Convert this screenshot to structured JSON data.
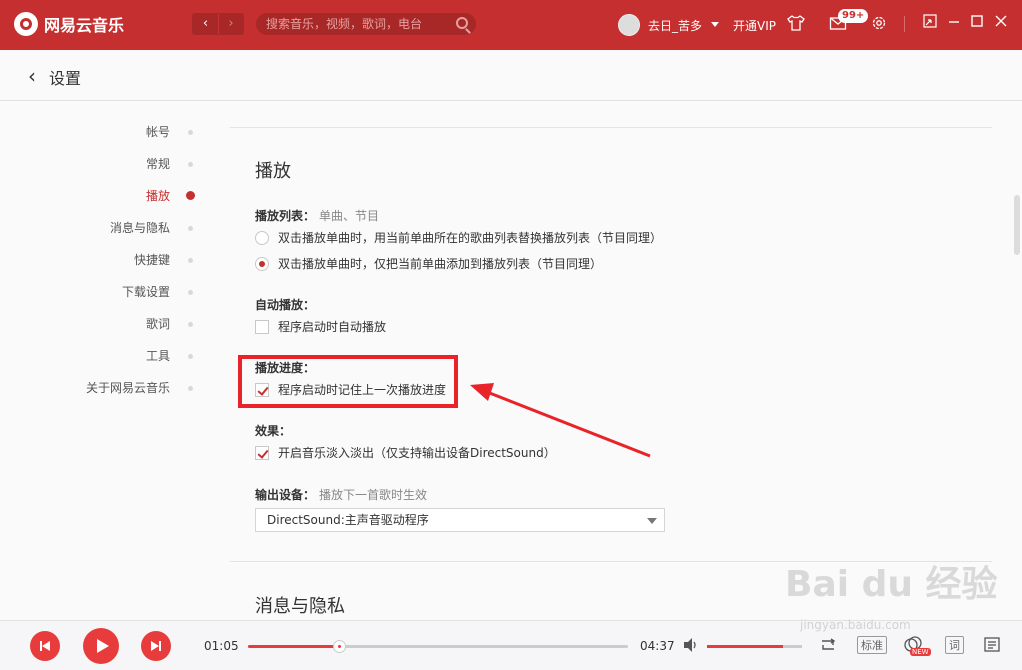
{
  "app": {
    "name": "网易云音乐"
  },
  "titlebar": {
    "nav_back": "‹",
    "nav_forward": "›",
    "search_placeholder": "搜索音乐，视频，歌词，电台",
    "username": "去日_苦多",
    "vip": "开通VIP",
    "message_badge": "99+"
  },
  "header": {
    "back": "‹",
    "title": "设置"
  },
  "sidebar": {
    "items": [
      {
        "label": "帐号"
      },
      {
        "label": "常规"
      },
      {
        "label": "播放",
        "active": true
      },
      {
        "label": "消息与隐私"
      },
      {
        "label": "快捷键"
      },
      {
        "label": "下载设置"
      },
      {
        "label": "歌词"
      },
      {
        "label": "工具"
      },
      {
        "label": "关于网易云音乐"
      }
    ]
  },
  "main": {
    "section_title": "播放",
    "playlist": {
      "label": "播放列表：",
      "hint": "单曲、节目",
      "options": [
        {
          "text": "双击播放单曲时，用当前单曲所在的歌曲列表替换播放列表（节目同理）",
          "selected": false
        },
        {
          "text": "双击播放单曲时，仅把当前单曲添加到播放列表（节目同理）",
          "selected": true
        }
      ]
    },
    "autoplay": {
      "label": "自动播放：",
      "option": "程序启动时自动播放",
      "checked": false
    },
    "progress": {
      "label": "播放进度：",
      "option": "程序启动时记住上一次播放进度",
      "checked": true
    },
    "effect": {
      "label": "效果：",
      "option": "开启音乐淡入淡出（仅支持输出设备DirectSound）",
      "checked": true
    },
    "output": {
      "label": "输出设备：",
      "hint": "播放下一首歌时生效",
      "selected": "DirectSound:主声音驱动程序"
    },
    "next_section_title": "消息与隐私"
  },
  "player": {
    "current_time": "01:05",
    "total_time": "04:37",
    "progress_fraction": 0.24,
    "volume_fraction": 0.8,
    "quality": "标准",
    "lyrics": "词",
    "new_badge": "NEW"
  },
  "watermark": {
    "text": "Bai du 经验",
    "sub": "jingyan.baidu.com"
  },
  "colors": {
    "accent": "#c62f2f",
    "highlight": "#e8232a",
    "player_red": "#e83c3c"
  }
}
